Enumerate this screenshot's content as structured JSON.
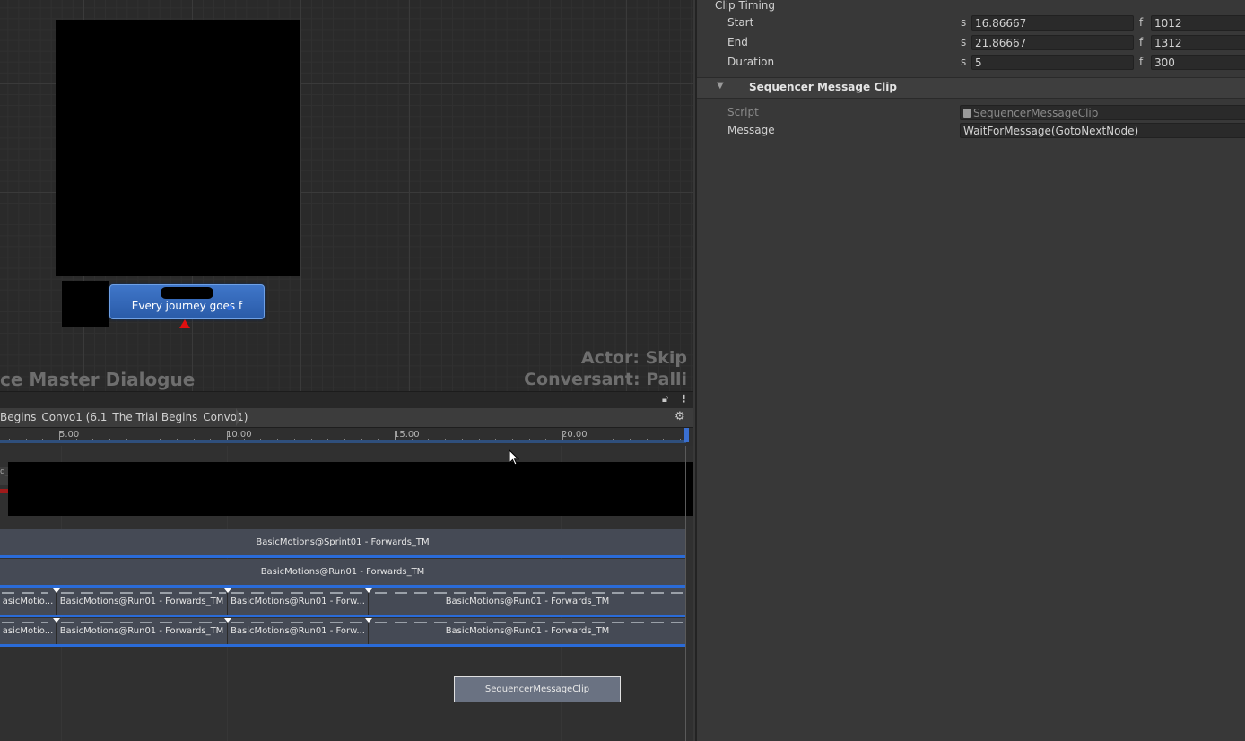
{
  "graph": {
    "node_text": "Every journey goes f",
    "actor_label": "Actor: Skip",
    "conversant_label": "Conversant: Palli",
    "dialogue_title": "ce Master Dialogue"
  },
  "timeline": {
    "lock_icon": "lock-icon",
    "menu_icon": "kebab-menu-icon",
    "breadcrumb": "Begins_Convo1 (6.1_The Trial Begins_Convo1)",
    "gear_icon": "gear-icon",
    "ruler_labels": [
      "5.00",
      "10.00",
      "15.00",
      "20.00"
    ],
    "left_clip_fragment": "d_",
    "tracks": [
      {
        "clips": [
          "BasicMotions@Sprint01 - Forwards_TM"
        ]
      },
      {
        "clips": [
          "BasicMotions@Run01 - Forwards_TM"
        ]
      },
      {
        "clips": [
          "asicMotio...",
          "BasicMotions@Run01 - Forwards_TM",
          "BasicMotions@Run01 - Forw...",
          "BasicMotions@Run01 - Forwards_TM"
        ]
      },
      {
        "clips": [
          "asicMotio...",
          "BasicMotions@Run01 - Forwards_TM",
          "BasicMotions@Run01 - Forw...",
          "BasicMotions@Run01 - Forwards_TM"
        ]
      }
    ],
    "message_clip": "SequencerMessageClip"
  },
  "inspector": {
    "clip_timing_label": "Clip Timing",
    "rows": [
      {
        "label": "Start",
        "s_unit": "s",
        "s_value": "16.86667",
        "f_unit": "f",
        "f_value": "1012"
      },
      {
        "label": "End",
        "s_unit": "s",
        "s_value": "21.86667",
        "f_unit": "f",
        "f_value": "1312"
      },
      {
        "label": "Duration",
        "s_unit": "s",
        "s_value": "5",
        "f_unit": "f",
        "f_value": "300"
      }
    ],
    "section_title": "Sequencer Message Clip",
    "script_label": "Script",
    "script_value": "SequencerMessageClip",
    "message_label": "Message",
    "message_value": "WaitForMessage(GotoNextNode)"
  },
  "colors": {
    "node_blue": "#2f62b3",
    "timeline_accent": "#2a6bd8",
    "red_arrow": "#e01010"
  }
}
